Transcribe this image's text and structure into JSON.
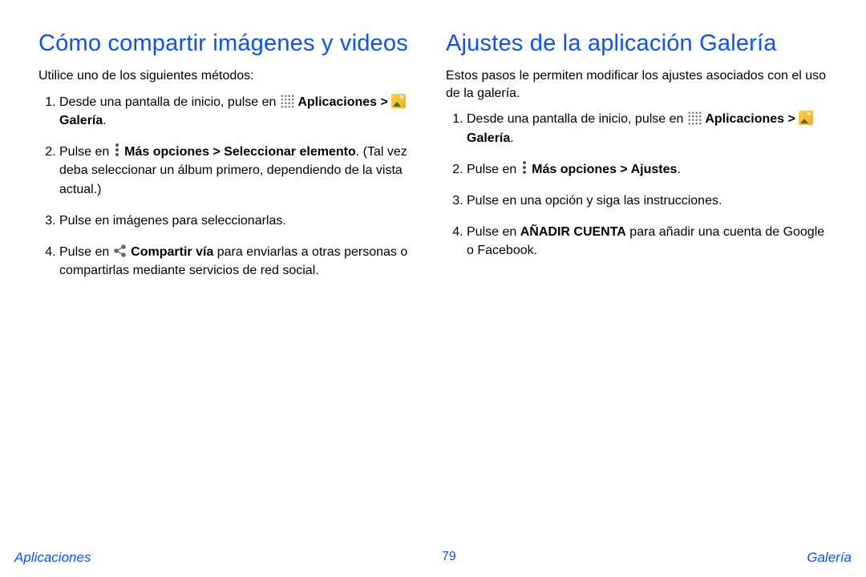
{
  "left": {
    "heading": "Cómo compartir imágenes y videos",
    "intro": "Utilice uno de los siguientes métodos:",
    "step1_a": "Desde una pantalla de inicio, pulse en",
    "step1_b_apps": "Aplicaciones",
    "step1_b_gt": " > ",
    "step1_b_gallery": "Galería",
    "step1_b_period": ".",
    "step2_a": "Pulse en",
    "step2_b": " Más opciones > Seleccionar elemento",
    "step2_c": ". (Tal vez deba seleccionar un álbum primero, dependiendo de la vista actual.)",
    "step3": "Pulse en imágenes para seleccionarlas.",
    "step4_a": "Pulse en",
    "step4_b": " Compartir vía",
    "step4_c": " para enviarlas a otras personas o compartirlas mediante servicios de red social."
  },
  "right": {
    "heading": "Ajustes de la aplicación Galería",
    "intro": "Estos pasos le permiten modificar los ajustes asociados con el uso de la galería.",
    "step1_a": "Desde una pantalla de inicio, pulse en",
    "step1_b_apps": "Aplicaciones",
    "step1_b_gt": " > ",
    "step1_b_gallery": "Galería",
    "step1_b_period": ".",
    "step2_a": "Pulse en",
    "step2_b": " Más opciones > Ajustes",
    "step2_c": ".",
    "step3": "Pulse en una opción y siga las instrucciones.",
    "step4_a": "Pulse en ",
    "step4_b": "AÑADIR CUENTA",
    "step4_c": " para añadir una cuenta de Google o Facebook."
  },
  "footer": {
    "left": "Aplicaciones",
    "page": "79",
    "right": "Galería"
  }
}
